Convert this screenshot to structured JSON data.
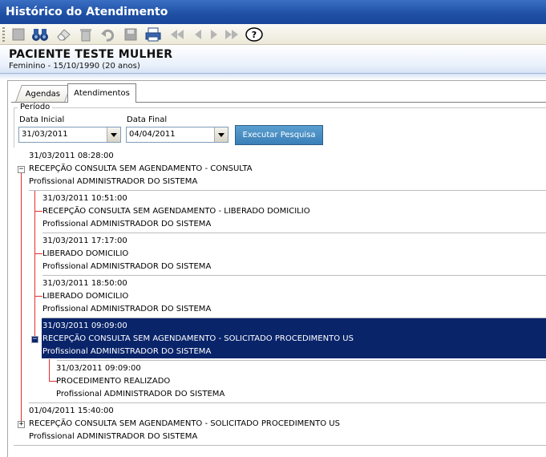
{
  "window": {
    "title": "Histórico do Atendimento"
  },
  "toolbar": {
    "icons": [
      "new-icon",
      "binoculars-icon",
      "eraser-icon",
      "trash-icon",
      "undo-icon",
      "save-icon",
      "printer-icon",
      "first-icon",
      "prev-icon",
      "next-icon",
      "last-icon",
      "help-icon"
    ]
  },
  "patient": {
    "name": "PACIENTE TESTE MULHER",
    "info": "Feminino - 15/10/1990 (20 anos)"
  },
  "tabs": [
    {
      "label": "Agendas"
    },
    {
      "label": "Atendimentos"
    }
  ],
  "filter": {
    "group_label": "Período",
    "start_label": "Data Inicial",
    "start_value": "31/03/2011",
    "end_label": "Data Final",
    "end_value": "04/04/2011",
    "search_button": "Executar Pesquisa"
  },
  "tree": {
    "n1": {
      "datetime": "31/03/2011 08:28:00",
      "title": "RECEPÇÃO CONSULTA SEM AGENDAMENTO - CONSULTA",
      "professional": "Profissional ADMINISTRADOR DO SISTEMA",
      "toggle": "−"
    },
    "n1a": {
      "datetime": "31/03/2011 10:51:00",
      "title": "RECEPÇÃO CONSULTA SEM AGENDAMENTO - LIBERADO DOMICILIO",
      "professional": "Profissional ADMINISTRADOR DO SISTEMA"
    },
    "n1b": {
      "datetime": "31/03/2011 17:17:00",
      "title": "LIBERADO DOMICILIO",
      "professional": "Profissional ADMINISTRADOR DO SISTEMA"
    },
    "n1c": {
      "datetime": "31/03/2011 18:50:00",
      "title": "LIBERADO DOMICILIO",
      "professional": "Profissional ADMINISTRADOR DO SISTEMA"
    },
    "n1d": {
      "datetime": "31/03/2011 09:09:00",
      "title": "RECEPÇÃO CONSULTA SEM AGENDAMENTO - SOLICITADO PROCEDIMENTO US",
      "professional": "Profissional ADMINISTRADOR DO SISTEMA",
      "toggle": "−"
    },
    "n1d1": {
      "datetime": "31/03/2011 09:09:00",
      "title": "PROCEDIMENTO REALIZADO",
      "professional": "Profissional ADMINISTRADOR DO SISTEMA"
    },
    "n2": {
      "datetime": "01/04/2011 15:40:00",
      "title": "RECEPÇÃO CONSULTA SEM AGENDAMENTO - SOLICITADO PROCEDIMENTO US",
      "professional": "Profissional ADMINISTRADOR DO SISTEMA",
      "toggle": "+"
    }
  },
  "colors": {
    "title_bar": "#1e4fa3",
    "selection": "#0a246a",
    "tree_line": "#e03030",
    "button": "#3a7fb8"
  }
}
